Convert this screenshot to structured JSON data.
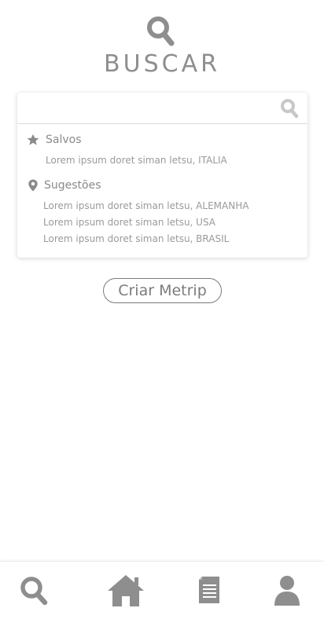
{
  "header": {
    "title": "BUSCAR",
    "icon": "search-icon"
  },
  "search": {
    "placeholder": "",
    "value": ""
  },
  "saved": {
    "label": "Salvos",
    "items": [
      "Lorem ipsum doret siman letsu, ITALIA"
    ]
  },
  "suggestions": {
    "label": "Sugestões",
    "items": [
      "Lorem ipsum doret siman letsu, ALEMANHA",
      "Lorem ipsum doret siman letsu, USA",
      "Lorem ipsum doret siman letsu, BRASIL"
    ]
  },
  "create_button": {
    "label": "Criar Metrip"
  },
  "bottom_nav": {
    "items": [
      {
        "icon": "search-icon"
      },
      {
        "icon": "home-icon"
      },
      {
        "icon": "document-icon"
      },
      {
        "icon": "profile-icon"
      }
    ]
  },
  "colors": {
    "icon": "#8e8e8e",
    "text": "#8a8a8a",
    "light_icon": "#c8c8c8"
  }
}
